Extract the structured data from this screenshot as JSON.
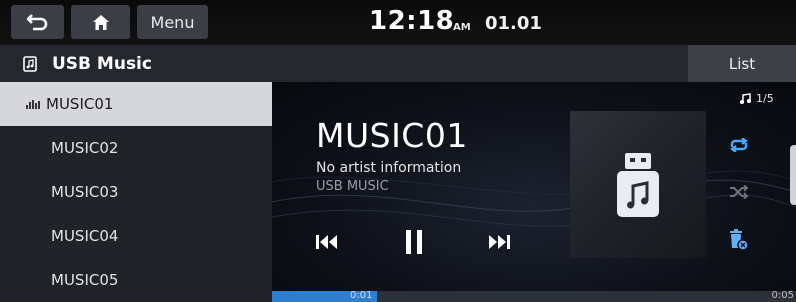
{
  "status_bar": {
    "menu_label": "Menu",
    "time": "12:18",
    "ampm": "AM",
    "date": "01.01",
    "icons": [
      "back-icon",
      "home-icon"
    ]
  },
  "source_bar": {
    "title": "USB Music",
    "list_label": "List",
    "icon": "usb-music-icon"
  },
  "tracks": [
    {
      "label": "MUSIC01",
      "active": true
    },
    {
      "label": "MUSIC02",
      "active": false
    },
    {
      "label": "MUSIC03",
      "active": false
    },
    {
      "label": "MUSIC04",
      "active": false
    },
    {
      "label": "MUSIC05",
      "active": false
    }
  ],
  "now_playing": {
    "title": "MUSIC01",
    "artist": "No artist information",
    "album": "USB MUSIC",
    "track_counter": "1/5",
    "playback_state": "playing",
    "repeat_mode": "repeat-all",
    "shuffle": false
  },
  "progress": {
    "elapsed": "0:01",
    "duration": "0:05",
    "fraction": 0.2
  },
  "colors": {
    "accent_blue": "#2f7fd1",
    "repeat_active": "#4aa8ff",
    "active_row_bg": "#d5d7da",
    "list_bg": "#202327"
  }
}
